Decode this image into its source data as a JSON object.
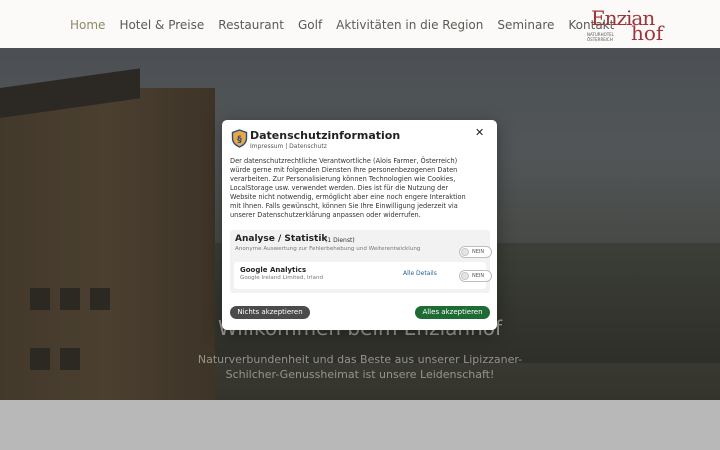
{
  "nav": {
    "items": [
      "Home",
      "Hotel & Preise",
      "Restaurant",
      "Golf",
      "Aktivitäten in die Region",
      "Seminare",
      "Kontakt"
    ],
    "active": "Home"
  },
  "logo": {
    "line1": "Enzian",
    "line2": "hof",
    "tagline": "NATURHOTEL ÖSTERREICH"
  },
  "hero": {
    "title": "Willkommen beim Enzianhof",
    "subtitle_line1": "Naturverbundenheit und das Beste aus unserer Lipizzaner-",
    "subtitle_line2": "Schilcher-Genussheimat ist unsere Leidenschaft!"
  },
  "modal": {
    "icon": "shield-paragraph-icon",
    "title": "Datenschutzinformation",
    "links": "Impressum | Datenschutz",
    "close_icon": "close-icon",
    "close_label": "✕",
    "body_lines": [
      "Der datenschutzrechtliche Verantwortliche (Alois Farmer, Österreich)",
      "würde gerne mit folgenden Diensten Ihre personenbezogenen Daten",
      "verarbeiten. Zur Personalisierung können Technologien wie Cookies,",
      "LocalStorage usw. verwendet werden. Dies ist für die Nutzung der",
      "Website nicht notwendig, ermöglicht aber eine noch engere Interaktion",
      "mit Ihnen. Falls gewünscht, können Sie Ihre Einwilligung jederzeit via",
      "unserer Datenschutzerklärung anpassen oder widerrufen."
    ],
    "category": {
      "title": "Analyse / Statistik",
      "count": "(1 Dienst)",
      "description": "Anonyme Auswertung zur Fehlerbehebung und Weiterentwicklung",
      "toggle_label": "NEIN"
    },
    "service": {
      "name": "Google Analytics",
      "provider": "Google Ireland Limited, Irland",
      "details_label": "Alle Details",
      "toggle_label": "NEIN"
    },
    "decline_label": "Nichts akzeptieren",
    "accept_label": "Alles akzeptieren"
  },
  "colors": {
    "accept": "#1e6b33",
    "decline": "#4b4b4b",
    "logo": "#a0323a",
    "nav_active": "#8c8a63"
  }
}
